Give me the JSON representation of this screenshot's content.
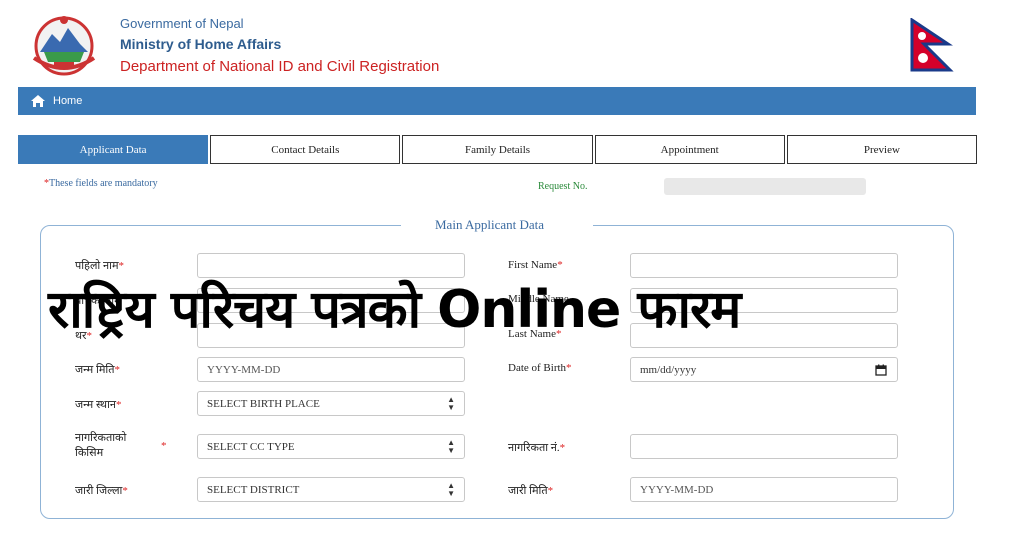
{
  "header": {
    "line1": "Government of Nepal",
    "line2": "Ministry of Home Affairs",
    "line3": "Department of National ID and Civil Registration"
  },
  "nav": {
    "home_label": "Home"
  },
  "tabs": [
    {
      "label": "Applicant Data",
      "active": true
    },
    {
      "label": "Contact Details",
      "active": false
    },
    {
      "label": "Family Details",
      "active": false
    },
    {
      "label": "Appointment",
      "active": false
    },
    {
      "label": "Preview",
      "active": false
    }
  ],
  "form": {
    "mandatory_note": "These fields are mandatory",
    "request_no_label": "Request No.",
    "legend": "Main Applicant Data",
    "first_name_np_label": "पहिलो नाम",
    "middle_name_np_label": "बीचको नाम",
    "last_name_np_label": "थर",
    "first_name_label": "First Name",
    "middle_name_label": "Middle Name",
    "last_name_label": "Last Name",
    "dob_np_label": "जन्म मिति",
    "dob_np_placeholder": "YYYY-MM-DD",
    "dob_label": "Date of Birth",
    "dob_placeholder": "mm/dd/yyyy",
    "birth_place_label": "जन्म स्थान",
    "birth_place_value": "SELECT BIRTH PLACE",
    "cc_type_label_1": "नागरिकताको",
    "cc_type_label_2": "किसिम",
    "cc_type_value": "SELECT CC TYPE",
    "cc_number_label": "नागरिकता नं.",
    "issue_district_label": "जारी जिल्ला",
    "issue_district_value": "SELECT DISTRICT",
    "issue_date_label": "जारी मिति",
    "issue_date_placeholder": "YYYY-MM-DD"
  },
  "overlay_title": "राष्ट्रिय परिचय पत्रको Online फारम",
  "colors": {
    "primary": "#3a7ab8",
    "required": "#dd2222",
    "ministry_red": "#cc2222"
  }
}
